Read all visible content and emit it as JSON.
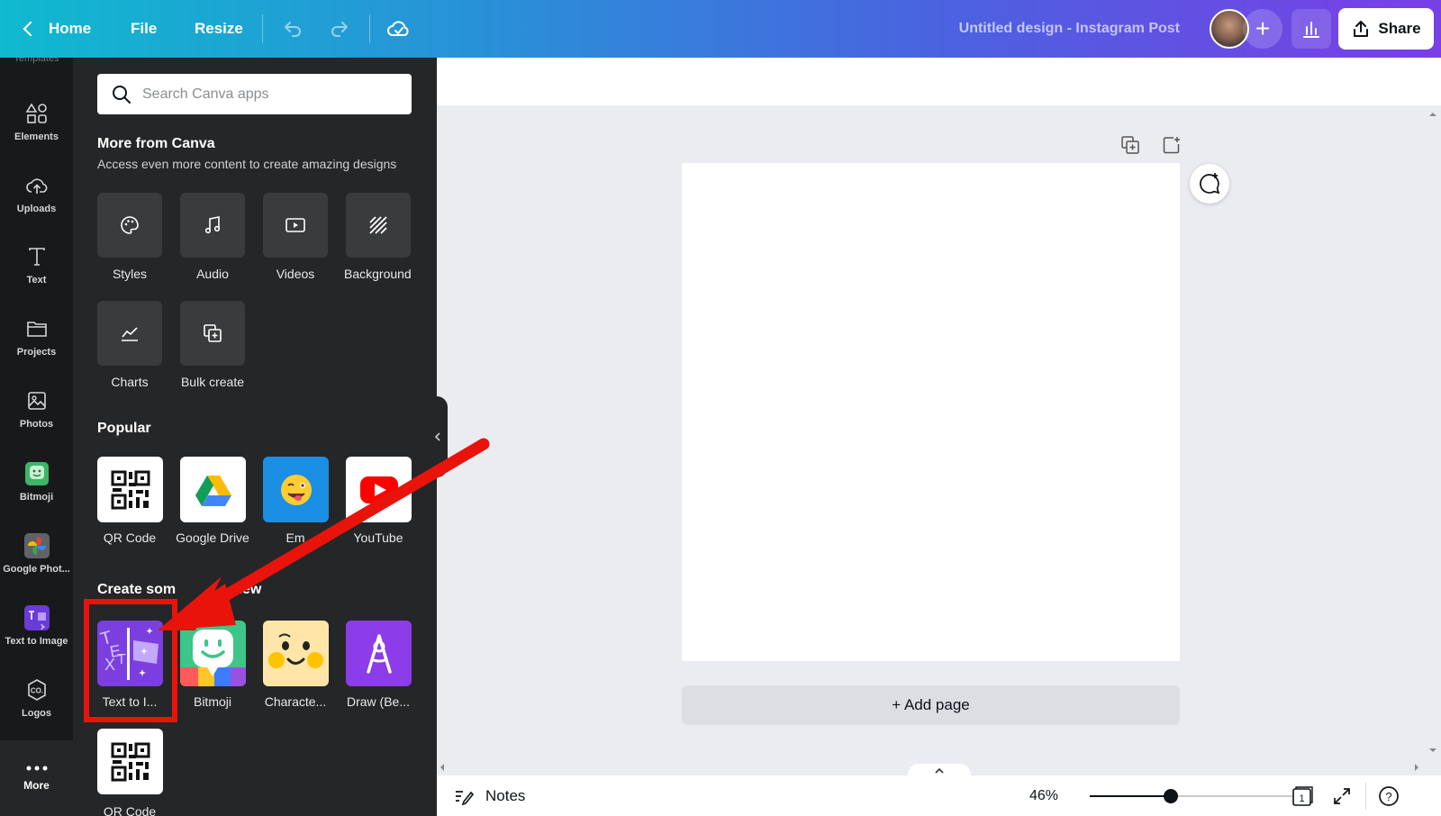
{
  "topbar": {
    "home": "Home",
    "file": "File",
    "resize": "Resize",
    "title": "Untitled design - Instagram Post",
    "share": "Share",
    "plus": "+"
  },
  "rail": {
    "cut_label": "Templates",
    "items": [
      {
        "label": "Elements",
        "icon": "elements-icon"
      },
      {
        "label": "Uploads",
        "icon": "cloud-upload-icon"
      },
      {
        "label": "Text",
        "icon": "text-icon"
      },
      {
        "label": "Projects",
        "icon": "folder-icon"
      },
      {
        "label": "Photos",
        "icon": "photo-icon"
      },
      {
        "label": "Bitmoji",
        "icon": "bitmoji-icon"
      },
      {
        "label": "Google Phot...",
        "icon": "google-photos-icon"
      },
      {
        "label": "Text to Image",
        "icon": "text-to-image-icon"
      },
      {
        "label": "Logos",
        "icon": "logos-icon"
      }
    ],
    "more": "More"
  },
  "panel": {
    "search_placeholder": "Search Canva apps",
    "more_title": "More from Canva",
    "more_sub": "Access even more content to create amazing designs",
    "more_tiles": [
      "Styles",
      "Audio",
      "Videos",
      "Background",
      "Charts",
      "Bulk create"
    ],
    "popular_title": "Popular",
    "popular_tiles": [
      "QR Code",
      "Google Drive",
      "Em",
      "YouTube"
    ],
    "create_title": "Create som",
    "create_title_tail": "new",
    "create_tiles": [
      "Text to I...",
      "Bitmoji",
      "Characte...",
      "Draw (Be..."
    ],
    "extra_tile": "QR Code"
  },
  "canvas": {
    "add_page": "+ Add page"
  },
  "bottombar": {
    "notes": "Notes",
    "zoom": "46%",
    "zoom_fraction": 0.4,
    "page_count": "1",
    "help": "?"
  },
  "colors": {
    "accent_red": "#e8140c",
    "panel_bg": "#252627",
    "rail_bg": "#18191b"
  }
}
